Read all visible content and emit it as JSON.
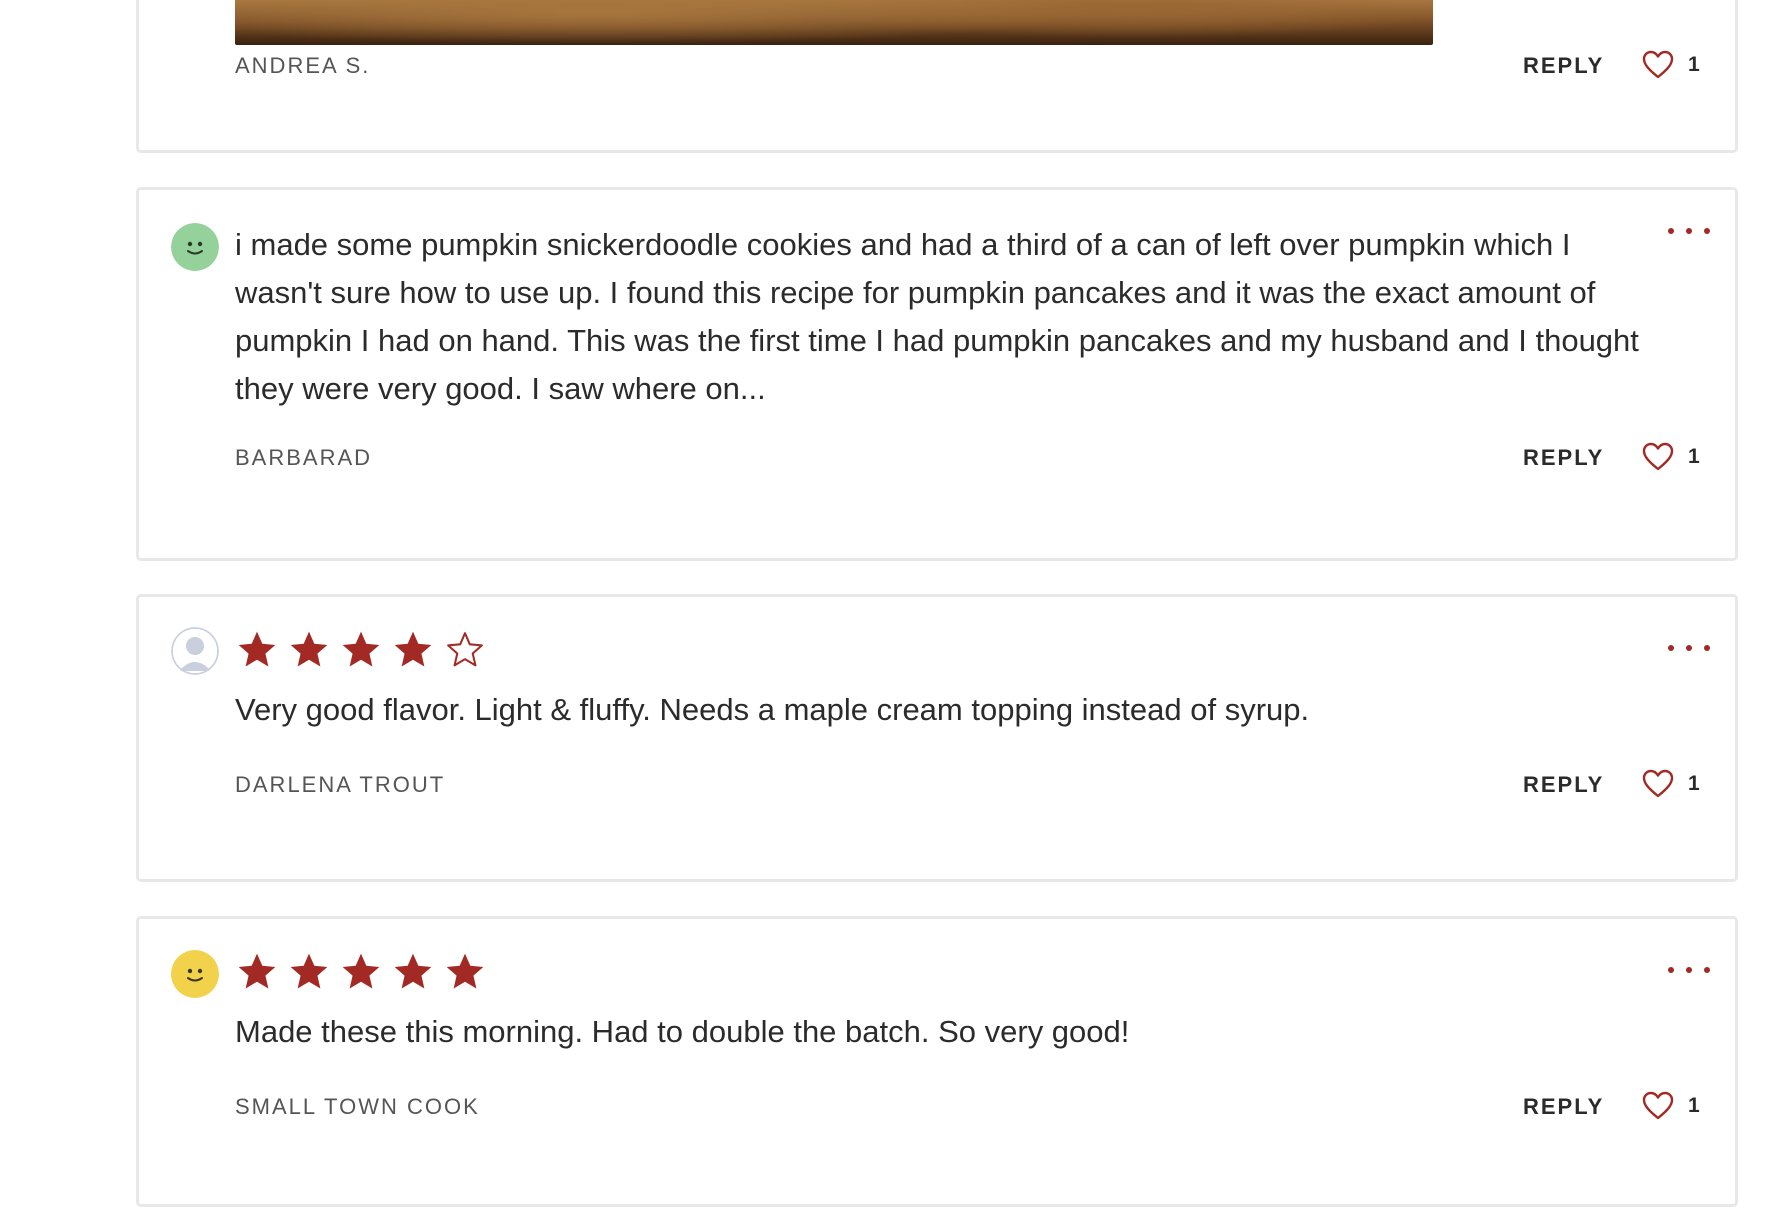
{
  "colors": {
    "accent": "#a32a24",
    "card_border": "#e8e8e8",
    "text": "#2b2b2b",
    "author": "#555555"
  },
  "reviews": [
    {
      "author": "ANDREA S.",
      "reply_label": "REPLY",
      "likes": "1",
      "has_photo": true
    },
    {
      "avatar": "smiley-green",
      "text": "i made some pumpkin snickerdoodle cookies and had a third of a can of left over pumpkin which I wasn't sure how to use up. I found this recipe for pumpkin pancakes and it was the exact amount of pumpkin I had on hand. This was the first time I had pumpkin pancakes and my husband and I thought they were very good. I saw where on...",
      "author": "BARBARAD",
      "reply_label": "REPLY",
      "likes": "1"
    },
    {
      "avatar": "default-user",
      "rating": 4,
      "rating_max": 5,
      "text": "Very good flavor. Light & fluffy. Needs a maple cream topping instead of syrup.",
      "author": "DARLENA TROUT",
      "reply_label": "REPLY",
      "likes": "1"
    },
    {
      "avatar": "smiley-yellow",
      "rating": 5,
      "rating_max": 5,
      "text": "Made these this morning. Had to double the batch. So very good!",
      "author": "SMALL TOWN COOK",
      "reply_label": "REPLY",
      "likes": "1"
    }
  ],
  "icons": {
    "like": "heart-outline-icon",
    "more": "more-dots-icon",
    "star_filled": "star-filled-icon",
    "star_empty": "star-outline-icon"
  }
}
